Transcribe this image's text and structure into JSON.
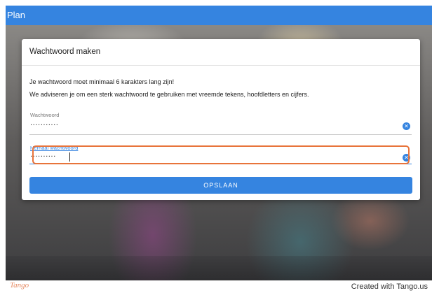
{
  "app": {
    "title": "Plan"
  },
  "dialog": {
    "title": "Wachtwoord maken",
    "info_line1": "Je wachtwoord moet minimaal 6 karakters lang zijn!",
    "info_line2": "We adviseren je om een sterk wachtwoord te gebruiken met vreemde tekens, hoofdletters en cijfers.",
    "password": {
      "label": "Wachtwoord",
      "value": "···········"
    },
    "repeat_password": {
      "label": "Herhaal wachtwoord",
      "value": "··········"
    },
    "save_label": "OPSLAAN"
  },
  "icons": {
    "clear": "clear-circle-icon"
  },
  "colors": {
    "accent": "#3584e0",
    "highlight": "#e8743b",
    "logo": "#e58a63"
  },
  "footer": {
    "logo": "Tango",
    "credit": "Created with Tango.us"
  }
}
